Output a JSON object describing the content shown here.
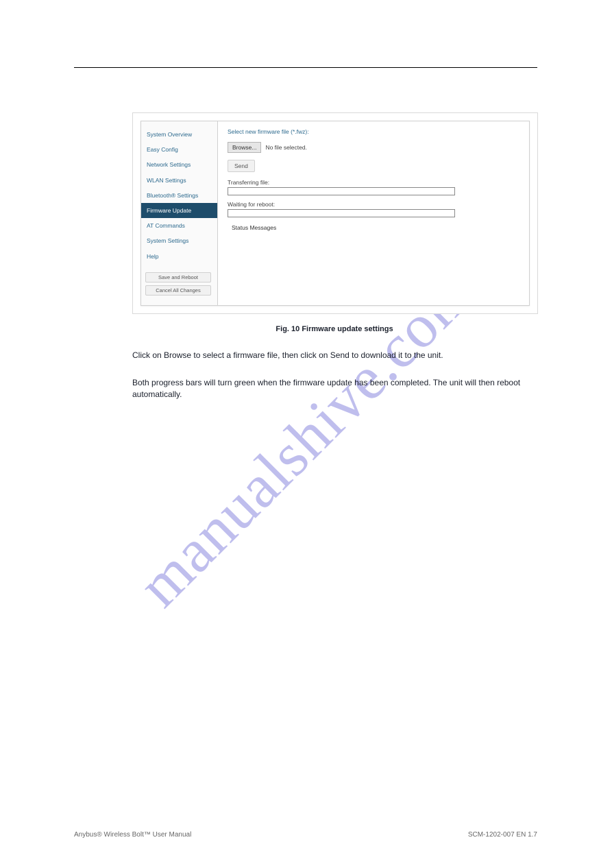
{
  "watermark": "manualshive.com",
  "sidebar": {
    "items": [
      {
        "label": "System Overview",
        "active": false
      },
      {
        "label": "Easy Config",
        "active": false
      },
      {
        "label": "Network Settings",
        "active": false
      },
      {
        "label": "WLAN Settings",
        "active": false
      },
      {
        "label": "Bluetooth® Settings",
        "active": false
      },
      {
        "label": "Firmware Update",
        "active": true
      },
      {
        "label": "AT Commands",
        "active": false
      },
      {
        "label": "System Settings",
        "active": false
      },
      {
        "label": "Help",
        "active": false
      }
    ],
    "save_button": "Save and Reboot",
    "cancel_button": "Cancel All Changes"
  },
  "main": {
    "heading": "Select new firmware file (*.fwz):",
    "browse_label": "Browse...",
    "file_status": "No file selected.",
    "send_label": "Send",
    "transferring": "Transferring file:",
    "waiting": "Waiting for reboot:",
    "status_heading": "Status Messages"
  },
  "figure_caption": "Fig. 10   Firmware update settings",
  "instructions": {
    "line1": "Click on Browse to select a firmware file, then click on Send to download it to the unit.",
    "line2": "Both progress bars will turn green when the firmware update has been completed. The unit will then reboot automatically."
  },
  "footer": {
    "left": "Anybus® Wireless Bolt™ User Manual",
    "right": "SCM-1202-007 EN 1.7"
  }
}
